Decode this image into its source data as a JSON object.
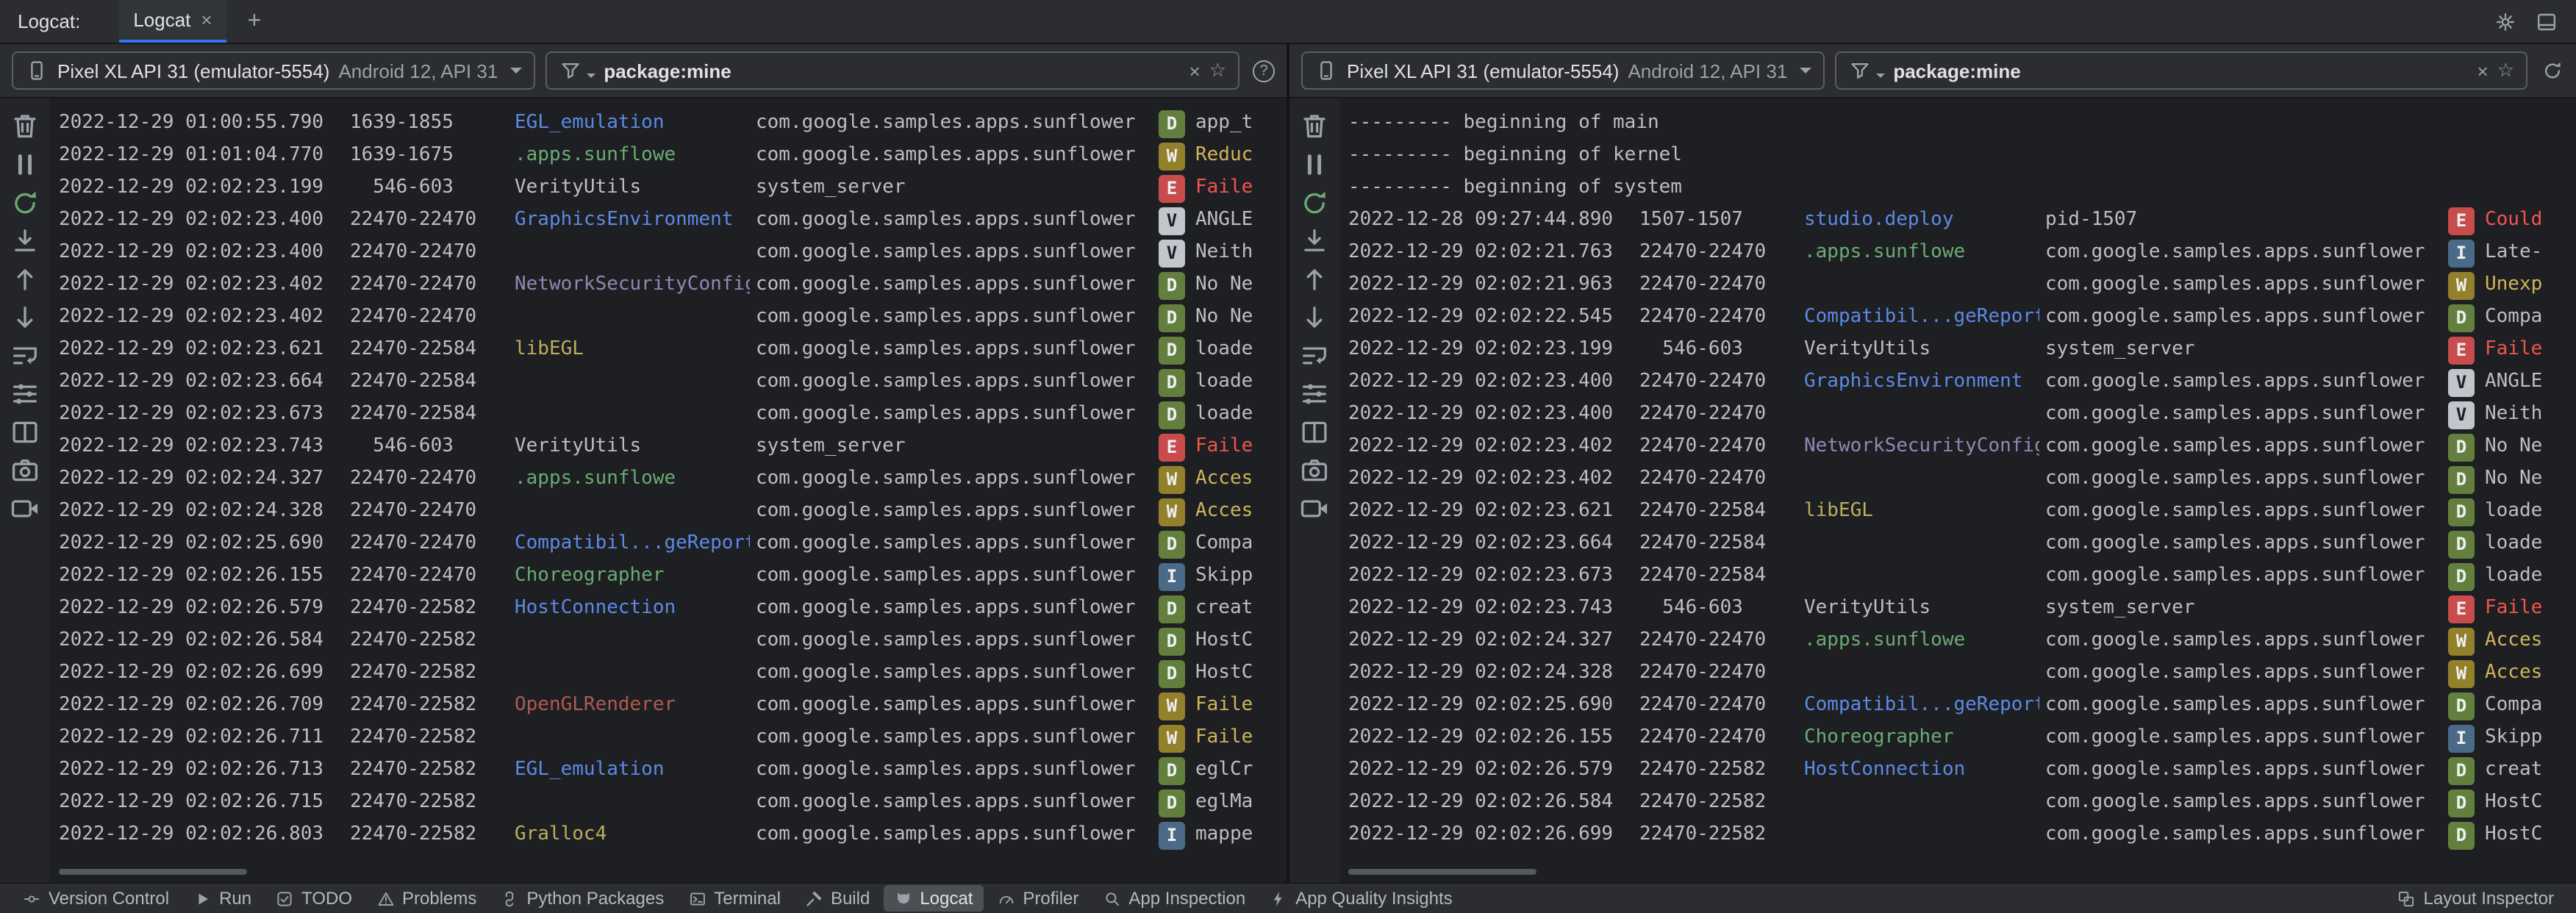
{
  "tab_bar": {
    "window_title": "Logcat:",
    "tab_label": "Logcat"
  },
  "misc": {
    "close": "×",
    "add": "+",
    "clear": "×",
    "favorite": "☆",
    "help": "?"
  },
  "device": {
    "name": "Pixel XL API 31 (emulator-5554)",
    "details": "Android 12, API 31"
  },
  "filter": {
    "value": "package:mine"
  },
  "side_toolbar": [
    "clear-logcat-icon",
    "pause-logcat-icon",
    "restart-logcat-icon",
    "scroll-to-end-icon",
    "previous-occurrence-icon",
    "next-occurrence-icon",
    "soft-wrap-icon",
    "formatting-options-icon",
    "split-panels-icon",
    "screenshot-icon",
    "screen-record-icon"
  ],
  "colors": {
    "accent": "#3574F0",
    "chrome": "#2B2D30",
    "log_bg": "#1E1F22",
    "default_text": "#BCBEC4"
  },
  "tag_colors": {
    "EGL_emulation": "#5C8AE6",
    ".apps.sunflowe": "#6AAB73",
    "VerityUtils": "#BCBEC4",
    "GraphicsEnvironment": "#5C8AE6",
    "NetworkSecurityConfig": "#9585B5",
    "libEGL": "#BBAE5C",
    "Compatibil...geReporter": "#5C8AE6",
    "Choreographer": "#6AAB73",
    "HostConnection": "#5C8AE6",
    "OpenGLRenderer": "#AE5A50",
    "Gralloc4": "#BBAE5C",
    "studio.deploy": "#5C8AE6"
  },
  "levels": {
    "V": {
      "bg": "#C2C5CB",
      "fg": "#1E1F22",
      "msg": "#BCBEC4"
    },
    "D": {
      "bg": "#637F3E",
      "fg": "#EDEFF1",
      "msg": "#BCBEC4"
    },
    "I": {
      "bg": "#4A6A87",
      "fg": "#EDEFF1",
      "msg": "#BCBEC4"
    },
    "W": {
      "bg": "#93802B",
      "fg": "#EDEFF1",
      "msg": "#D0B35C"
    },
    "E": {
      "bg": "#C84C4C",
      "fg": "#EDEFF1",
      "msg": "#F0544F"
    }
  },
  "panes": [
    {
      "rows": [
        {
          "t": "2022-12-29 01:00:55.790",
          "p": "1639-1855",
          "tag": "EGL_emulation",
          "pkg": "com.google.samples.apps.sunflower",
          "lvl": "D",
          "msg": "app_t"
        },
        {
          "t": "2022-12-29 01:01:04.770",
          "p": "1639-1675",
          "tag": ".apps.sunflowe",
          "pkg": "com.google.samples.apps.sunflower",
          "lvl": "W",
          "msg": "Reduc"
        },
        {
          "t": "2022-12-29 02:02:23.199",
          "p": "  546-603",
          "tag": "VerityUtils",
          "pkg": "system_server",
          "lvl": "E",
          "msg": "Faile"
        },
        {
          "t": "2022-12-29 02:02:23.400",
          "p": "22470-22470",
          "tag": "GraphicsEnvironment",
          "pkg": "com.google.samples.apps.sunflower",
          "lvl": "V",
          "msg": "ANGLE"
        },
        {
          "t": "2022-12-29 02:02:23.400",
          "p": "22470-22470",
          "tag": "",
          "pkg": "com.google.samples.apps.sunflower",
          "lvl": "V",
          "msg": "Neith"
        },
        {
          "t": "2022-12-29 02:02:23.402",
          "p": "22470-22470",
          "tag": "NetworkSecurityConfig",
          "pkg": "com.google.samples.apps.sunflower",
          "lvl": "D",
          "msg": "No Ne"
        },
        {
          "t": "2022-12-29 02:02:23.402",
          "p": "22470-22470",
          "tag": "",
          "pkg": "com.google.samples.apps.sunflower",
          "lvl": "D",
          "msg": "No Ne"
        },
        {
          "t": "2022-12-29 02:02:23.621",
          "p": "22470-22584",
          "tag": "libEGL",
          "pkg": "com.google.samples.apps.sunflower",
          "lvl": "D",
          "msg": "loade"
        },
        {
          "t": "2022-12-29 02:02:23.664",
          "p": "22470-22584",
          "tag": "",
          "pkg": "com.google.samples.apps.sunflower",
          "lvl": "D",
          "msg": "loade"
        },
        {
          "t": "2022-12-29 02:02:23.673",
          "p": "22470-22584",
          "tag": "",
          "pkg": "com.google.samples.apps.sunflower",
          "lvl": "D",
          "msg": "loade"
        },
        {
          "t": "2022-12-29 02:02:23.743",
          "p": "  546-603",
          "tag": "VerityUtils",
          "pkg": "system_server",
          "lvl": "E",
          "msg": "Faile"
        },
        {
          "t": "2022-12-29 02:02:24.327",
          "p": "22470-22470",
          "tag": ".apps.sunflowe",
          "pkg": "com.google.samples.apps.sunflower",
          "lvl": "W",
          "msg": "Acces"
        },
        {
          "t": "2022-12-29 02:02:24.328",
          "p": "22470-22470",
          "tag": "",
          "pkg": "com.google.samples.apps.sunflower",
          "lvl": "W",
          "msg": "Acces"
        },
        {
          "t": "2022-12-29 02:02:25.690",
          "p": "22470-22470",
          "tag": "Compatibil...geReporter",
          "pkg": "com.google.samples.apps.sunflower",
          "lvl": "D",
          "msg": "Compa"
        },
        {
          "t": "2022-12-29 02:02:26.155",
          "p": "22470-22470",
          "tag": "Choreographer",
          "pkg": "com.google.samples.apps.sunflower",
          "lvl": "I",
          "msg": "Skipp"
        },
        {
          "t": "2022-12-29 02:02:26.579",
          "p": "22470-22582",
          "tag": "HostConnection",
          "pkg": "com.google.samples.apps.sunflower",
          "lvl": "D",
          "msg": "creat"
        },
        {
          "t": "2022-12-29 02:02:26.584",
          "p": "22470-22582",
          "tag": "",
          "pkg": "com.google.samples.apps.sunflower",
          "lvl": "D",
          "msg": "HostC"
        },
        {
          "t": "2022-12-29 02:02:26.699",
          "p": "22470-22582",
          "tag": "",
          "pkg": "com.google.samples.apps.sunflower",
          "lvl": "D",
          "msg": "HostC"
        },
        {
          "t": "2022-12-29 02:02:26.709",
          "p": "22470-22582",
          "tag": "OpenGLRenderer",
          "pkg": "com.google.samples.apps.sunflower",
          "lvl": "W",
          "msg": "Faile"
        },
        {
          "t": "2022-12-29 02:02:26.711",
          "p": "22470-22582",
          "tag": "",
          "pkg": "com.google.samples.apps.sunflower",
          "lvl": "W",
          "msg": "Faile"
        },
        {
          "t": "2022-12-29 02:02:26.713",
          "p": "22470-22582",
          "tag": "EGL_emulation",
          "pkg": "com.google.samples.apps.sunflower",
          "lvl": "D",
          "msg": "eglCr"
        },
        {
          "t": "2022-12-29 02:02:26.715",
          "p": "22470-22582",
          "tag": "",
          "pkg": "com.google.samples.apps.sunflower",
          "lvl": "D",
          "msg": "eglMa"
        },
        {
          "t": "2022-12-29 02:02:26.803",
          "p": "22470-22582",
          "tag": "Gralloc4",
          "pkg": "com.google.samples.apps.sunflower",
          "lvl": "I",
          "msg": "mappe"
        }
      ]
    },
    {
      "rows": [
        {
          "banner": "--------- beginning of main"
        },
        {
          "banner": "--------- beginning of kernel"
        },
        {
          "banner": "--------- beginning of system"
        },
        {
          "t": "2022-12-28 09:27:44.890",
          "p": "1507-1507",
          "tag": "studio.deploy",
          "pkg": "pid-1507",
          "lvl": "E",
          "msg": "Could"
        },
        {
          "t": "2022-12-29 02:02:21.763",
          "p": "22470-22470",
          "tag": ".apps.sunflowe",
          "pkg": "com.google.samples.apps.sunflower",
          "lvl": "I",
          "msg": "Late-"
        },
        {
          "t": "2022-12-29 02:02:21.963",
          "p": "22470-22470",
          "tag": "",
          "pkg": "com.google.samples.apps.sunflower",
          "lvl": "W",
          "msg": "Unexp"
        },
        {
          "t": "2022-12-29 02:02:22.545",
          "p": "22470-22470",
          "tag": "Compatibil...geReporter",
          "pkg": "com.google.samples.apps.sunflower",
          "lvl": "D",
          "msg": "Compa"
        },
        {
          "t": "2022-12-29 02:02:23.199",
          "p": "  546-603",
          "tag": "VerityUtils",
          "pkg": "system_server",
          "lvl": "E",
          "msg": "Faile"
        },
        {
          "t": "2022-12-29 02:02:23.400",
          "p": "22470-22470",
          "tag": "GraphicsEnvironment",
          "pkg": "com.google.samples.apps.sunflower",
          "lvl": "V",
          "msg": "ANGLE"
        },
        {
          "t": "2022-12-29 02:02:23.400",
          "p": "22470-22470",
          "tag": "",
          "pkg": "com.google.samples.apps.sunflower",
          "lvl": "V",
          "msg": "Neith"
        },
        {
          "t": "2022-12-29 02:02:23.402",
          "p": "22470-22470",
          "tag": "NetworkSecurityConfig",
          "pkg": "com.google.samples.apps.sunflower",
          "lvl": "D",
          "msg": "No Ne"
        },
        {
          "t": "2022-12-29 02:02:23.402",
          "p": "22470-22470",
          "tag": "",
          "pkg": "com.google.samples.apps.sunflower",
          "lvl": "D",
          "msg": "No Ne"
        },
        {
          "t": "2022-12-29 02:02:23.621",
          "p": "22470-22584",
          "tag": "libEGL",
          "pkg": "com.google.samples.apps.sunflower",
          "lvl": "D",
          "msg": "loade"
        },
        {
          "t": "2022-12-29 02:02:23.664",
          "p": "22470-22584",
          "tag": "",
          "pkg": "com.google.samples.apps.sunflower",
          "lvl": "D",
          "msg": "loade"
        },
        {
          "t": "2022-12-29 02:02:23.673",
          "p": "22470-22584",
          "tag": "",
          "pkg": "com.google.samples.apps.sunflower",
          "lvl": "D",
          "msg": "loade"
        },
        {
          "t": "2022-12-29 02:02:23.743",
          "p": "  546-603",
          "tag": "VerityUtils",
          "pkg": "system_server",
          "lvl": "E",
          "msg": "Faile"
        },
        {
          "t": "2022-12-29 02:02:24.327",
          "p": "22470-22470",
          "tag": ".apps.sunflowe",
          "pkg": "com.google.samples.apps.sunflower",
          "lvl": "W",
          "msg": "Acces"
        },
        {
          "t": "2022-12-29 02:02:24.328",
          "p": "22470-22470",
          "tag": "",
          "pkg": "com.google.samples.apps.sunflower",
          "lvl": "W",
          "msg": "Acces"
        },
        {
          "t": "2022-12-29 02:02:25.690",
          "p": "22470-22470",
          "tag": "Compatibil...geReporter",
          "pkg": "com.google.samples.apps.sunflower",
          "lvl": "D",
          "msg": "Compa"
        },
        {
          "t": "2022-12-29 02:02:26.155",
          "p": "22470-22470",
          "tag": "Choreographer",
          "pkg": "com.google.samples.apps.sunflower",
          "lvl": "I",
          "msg": "Skipp"
        },
        {
          "t": "2022-12-29 02:02:26.579",
          "p": "22470-22582",
          "tag": "HostConnection",
          "pkg": "com.google.samples.apps.sunflower",
          "lvl": "D",
          "msg": "creat"
        },
        {
          "t": "2022-12-29 02:02:26.584",
          "p": "22470-22582",
          "tag": "",
          "pkg": "com.google.samples.apps.sunflower",
          "lvl": "D",
          "msg": "HostC"
        },
        {
          "t": "2022-12-29 02:02:26.699",
          "p": "22470-22582",
          "tag": "",
          "pkg": "com.google.samples.apps.sunflower",
          "lvl": "D",
          "msg": "HostC"
        }
      ]
    }
  ],
  "status_bar": {
    "items": [
      {
        "label": "Version Control",
        "icon": "version-control-icon"
      },
      {
        "label": "Run",
        "icon": "run-icon"
      },
      {
        "label": "TODO",
        "icon": "todo-icon"
      },
      {
        "label": "Problems",
        "icon": "problems-icon"
      },
      {
        "label": "Python Packages",
        "icon": "python-packages-icon"
      },
      {
        "label": "Terminal",
        "icon": "terminal-icon"
      },
      {
        "label": "Build",
        "icon": "build-icon"
      },
      {
        "label": "Logcat",
        "icon": "logcat-icon",
        "selected": true
      },
      {
        "label": "Profiler",
        "icon": "profiler-icon"
      },
      {
        "label": "App Inspection",
        "icon": "app-inspection-icon"
      },
      {
        "label": "App Quality Insights",
        "icon": "app-quality-insights-icon"
      }
    ],
    "right": {
      "label": "Layout Inspector",
      "icon": "layout-inspector-icon"
    }
  }
}
